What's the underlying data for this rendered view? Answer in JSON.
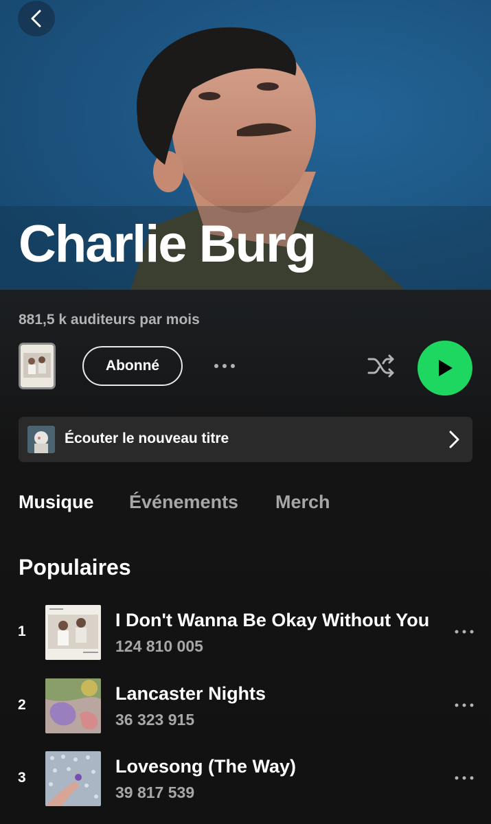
{
  "artist": {
    "name": "Charlie Burg",
    "monthly_listeners": "881,5 k auditeurs par mois"
  },
  "controls": {
    "follow_label": "Abonné",
    "icons": [
      "back-chevron-icon",
      "more-dots-icon",
      "shuffle-icon",
      "play-icon"
    ],
    "accent_color": "#1ed760"
  },
  "promo": {
    "label": "Écouter le nouveau titre"
  },
  "tabs": [
    {
      "label": "Musique",
      "active": true
    },
    {
      "label": "Événements",
      "active": false
    },
    {
      "label": "Merch",
      "active": false
    }
  ],
  "popular": {
    "title": "Populaires",
    "tracks": [
      {
        "rank": "1",
        "title": "I Don't Wanna Be Okay Without You",
        "plays": "124 810 005"
      },
      {
        "rank": "2",
        "title": "Lancaster Nights",
        "plays": "36 323 915"
      },
      {
        "rank": "3",
        "title": "Lovesong (The Way)",
        "plays": "39 817 539"
      }
    ]
  }
}
